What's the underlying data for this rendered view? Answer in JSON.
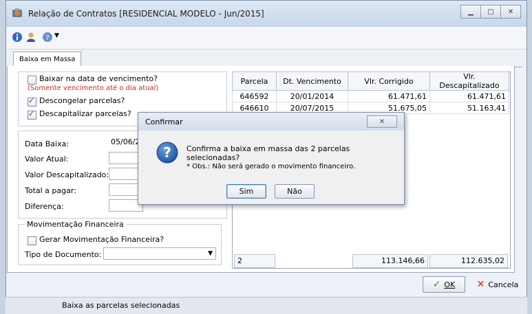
{
  "window": {
    "title": "Relação de Contratos [RESIDENCIAL MODELO - Jun/2015]"
  },
  "tabs": [
    "Baixa em Massa"
  ],
  "options": {
    "baixar_vencimento": "Baixar na data de vencimento?",
    "vencimento_note": "(Somente vencimento até o dia atual)",
    "descongelar": "Descongelar parcelas?",
    "descapitalizar": "Descapitalizar parcelas?"
  },
  "form": {
    "data_baixa_label": "Data Baixa:",
    "data_baixa_value": "05/06/2",
    "valor_atual_label": "Valor Atual:",
    "valor_descap_label": "Valor Descapitalizado:",
    "total_label": "Total a pagar:",
    "diferenca_label": "Diferença:"
  },
  "movimentacao": {
    "group_title": "Movimentação Financeira",
    "gerar_label": "Gerar Movimentação Financeira?",
    "tipo_label": "Tipo de Documento:"
  },
  "grid": {
    "columns": [
      "Parcela",
      "Dt. Vencimento",
      "Vlr. Corrigido",
      "Vlr. Descapitalizado"
    ],
    "rows": [
      [
        "646592",
        "20/01/2014",
        "61.471,61",
        "61.471,61"
      ],
      [
        "646610",
        "20/07/2015",
        "51.675,05",
        "51.163,41"
      ]
    ],
    "footer": {
      "count": "2",
      "total_corrigido": "113.146,66",
      "total_descap": "112.635,02"
    }
  },
  "buttons": {
    "ok": "OK",
    "cancel": "Cancela"
  },
  "status": "Baixa as parcelas selecionadas",
  "dialog": {
    "title": "Confirmar",
    "message": "Confirma a baixa em massa das 2 parcelas selecionadas?",
    "note": "* Obs.: Não será gerado o movimento financeiro.",
    "yes": "Sim",
    "no": "Não"
  },
  "colors": {
    "accent": "#2d6bbf",
    "warning_text": "#d02a1a",
    "ok_green": "#3a9a2a",
    "cancel_red": "#d0301e"
  }
}
